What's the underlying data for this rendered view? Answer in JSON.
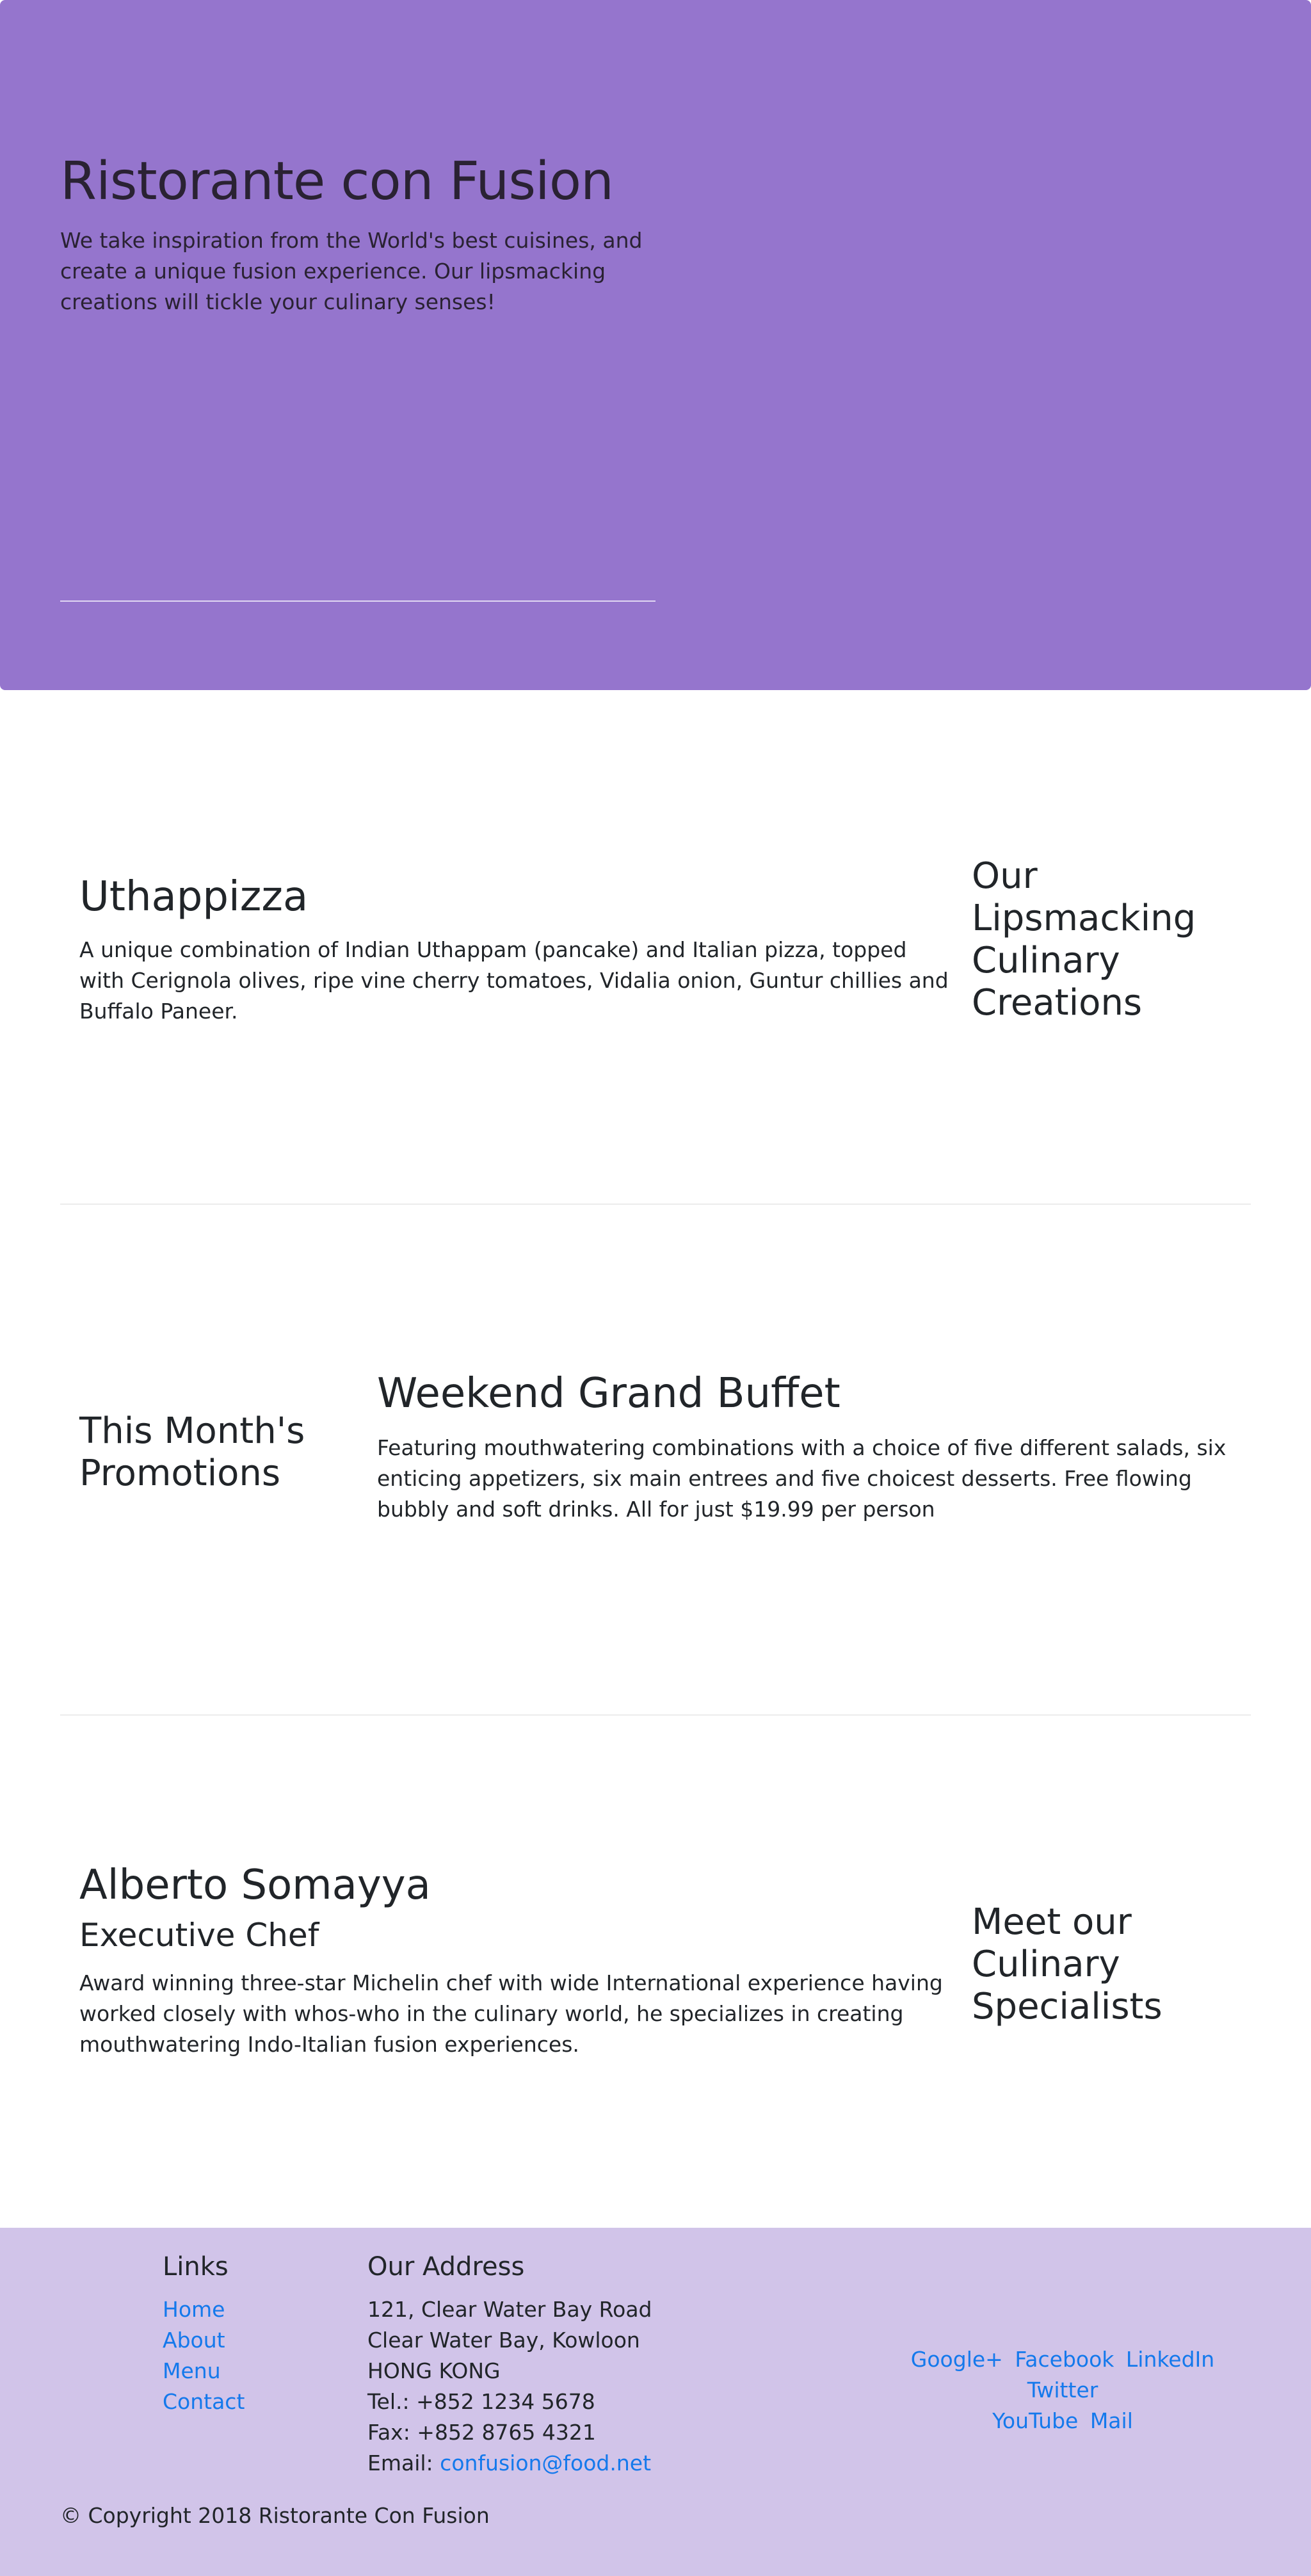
{
  "jumbotron": {
    "title": "Ristorante con Fusion",
    "description": "We take inspiration from the World's best cuisines, and create a unique fusion experience. Our lipsmacking creations will tickle your culinary senses!"
  },
  "dish": {
    "section_heading": "Our Lipsmacking Culinary Creations",
    "name": "Uthappizza",
    "description": "A unique combination of Indian Uthappam (pancake) and Italian pizza, topped with Cerignola olives, ripe vine cherry tomatoes, Vidalia onion, Guntur chillies and Buffalo Paneer."
  },
  "promotion": {
    "section_heading": "This Month's Promotions",
    "name": "Weekend Grand Buffet",
    "description": "Featuring mouthwatering combinations with a choice of five different salads, six enticing appetizers, six main entrees and five choicest desserts. Free flowing bubbly and soft drinks. All for just $19.99 per person"
  },
  "leader": {
    "section_heading": "Meet our Culinary Specialists",
    "name": "Alberto Somayya",
    "title": "Executive Chef",
    "description": "Award winning three-star Michelin chef with wide International experience having worked closely with whos-who in the culinary world, he specializes in creating mouthwatering Indo-Italian fusion experiences."
  },
  "footer": {
    "links_heading": "Links",
    "links": [
      "Home",
      "About",
      "Menu",
      "Contact"
    ],
    "address_heading": "Our Address",
    "address_lines": [
      "121, Clear Water Bay Road",
      "Clear Water Bay, Kowloon",
      "HONG KONG",
      "Tel.: +852 1234 5678",
      "Fax: +852 8765 4321"
    ],
    "email_label": "Email: ",
    "email": "confusion@food.net",
    "social": [
      "Google+",
      "Facebook",
      "LinkedIn",
      "Twitter",
      "YouTube",
      "Mail"
    ],
    "copyright": "© Copyright 2018 Ristorante Con Fusion"
  },
  "colors": {
    "jumbotron_bg": "#9575cd",
    "footer_bg": "#d1c4e9",
    "link": "#1479ec"
  }
}
